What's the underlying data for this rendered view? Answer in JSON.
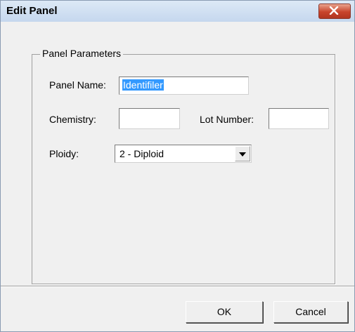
{
  "window": {
    "title": "Edit Panel",
    "close_icon": "close-x-icon",
    "close_color": "#c8442c"
  },
  "group": {
    "label": "Panel Parameters"
  },
  "fields": {
    "panel_name_label": "Panel Name:",
    "panel_name_value": "Identifiler",
    "chemistry_label": "Chemistry:",
    "chemistry_value": "",
    "lot_number_label": "Lot Number:",
    "lot_number_value": "",
    "ploidy_label": "Ploidy:",
    "ploidy_value": "2 - Diploid"
  },
  "buttons": {
    "ok": "OK",
    "cancel": "Cancel"
  },
  "colors": {
    "selection": "#3399ff",
    "dialog_bg": "#f0f0f0"
  }
}
